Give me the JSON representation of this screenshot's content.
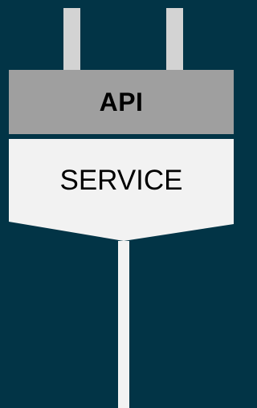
{
  "colors": {
    "background": "#023446",
    "prongs": "#d3d3d3",
    "api_block": "#9f9f9f",
    "service_block": "#f2f2f2",
    "cable": "#f2f2f2",
    "text": "#000000"
  },
  "diagram": {
    "api_label": "API",
    "service_label": "SERVICE"
  }
}
